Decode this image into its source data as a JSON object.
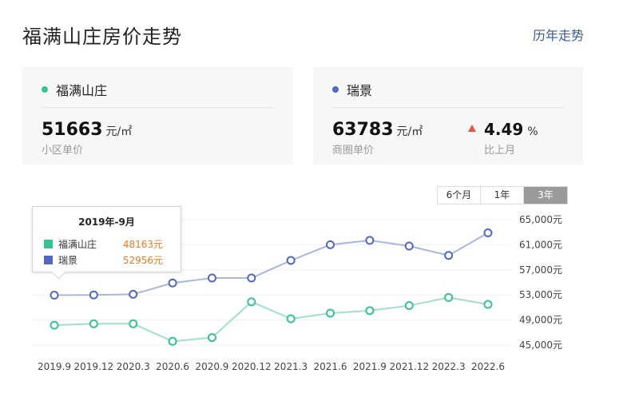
{
  "page": {
    "title": "福满山庄房价走势",
    "history_link": "历年走势"
  },
  "cards": {
    "community": {
      "name": "福满山庄",
      "price": "51663",
      "unit": "元/㎡",
      "desc": "小区单价",
      "dot_color": "#35c48e"
    },
    "district": {
      "name": "瑞景",
      "price": "63783",
      "unit": "元/㎡",
      "desc": "商圈单价",
      "change": "4.49",
      "change_unit": "%",
      "change_desc": "比上月",
      "dot_color": "#5068c2"
    }
  },
  "range_tabs": [
    {
      "label": "6个月",
      "active": false
    },
    {
      "label": "1年",
      "active": false
    },
    {
      "label": "3年",
      "active": true
    }
  ],
  "tooltip": {
    "title": "2019年-9月",
    "rows": [
      {
        "name": "福满山庄",
        "value": "48163元",
        "color": "#35c48e"
      },
      {
        "name": "瑞景",
        "value": "52956元",
        "color": "#5068c2"
      }
    ]
  },
  "chart_data": {
    "type": "line",
    "title": "",
    "xlabel": "",
    "ylabel": "",
    "x": [
      "2019.9",
      "2019.12",
      "2020.3",
      "2020.6",
      "2020.9",
      "2020.12",
      "2021.3",
      "2021.6",
      "2021.9",
      "2021.12",
      "2022.3",
      "2022.6"
    ],
    "yticks": [
      45000,
      49000,
      53000,
      57000,
      61000,
      65000
    ],
    "ytick_labels": [
      "45,000元",
      "49,000元",
      "53,000元",
      "57,000元",
      "61,000元",
      "65,000元"
    ],
    "ylim": [
      45000,
      65000
    ],
    "grid": true,
    "legend": "none",
    "series": [
      {
        "name": "瑞景",
        "color": "#5068c2",
        "line_color": "#a9b6dc",
        "values": [
          52956,
          53000,
          53100,
          54900,
          55700,
          55700,
          58500,
          61000,
          61700,
          60800,
          59300,
          62900
        ]
      },
      {
        "name": "福满山庄",
        "color": "#35c48e",
        "line_color": "#9fe0c6",
        "values": [
          48163,
          48400,
          48400,
          45600,
          46200,
          51900,
          49200,
          50100,
          50500,
          51300,
          52600,
          51500
        ]
      }
    ]
  }
}
